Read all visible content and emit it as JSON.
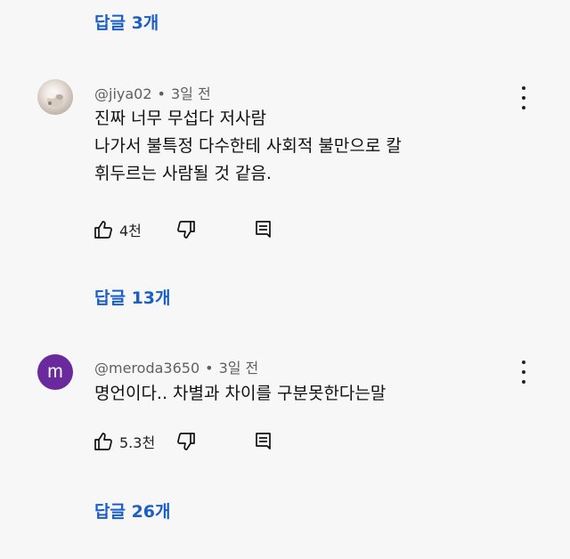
{
  "threads": [
    {
      "replies_label": "답글 3개"
    },
    {
      "author": "@jiya02",
      "time": "3일 전",
      "lines": [
        "진짜 너무 무섭다 저사람",
        "나가서 불특정 다수한테 사회적 불만으로 칼",
        "휘두르는 사람될 것 같음."
      ],
      "likes": "4천",
      "avatar_icon": "photo-avatar",
      "replies_label": "답글 13개"
    },
    {
      "author": "@meroda3650",
      "time": "3일 전",
      "avatar_letter": "m",
      "lines": [
        "명언이다.. 차별과 차이를 구분못한다는말"
      ],
      "likes": "5.3천",
      "replies_label": "답글 26개"
    }
  ],
  "meta_separator": "•",
  "colors": {
    "link": "#1b5fc6",
    "avatar_m": "#6a2a9e",
    "background": "#f7f7f7"
  }
}
